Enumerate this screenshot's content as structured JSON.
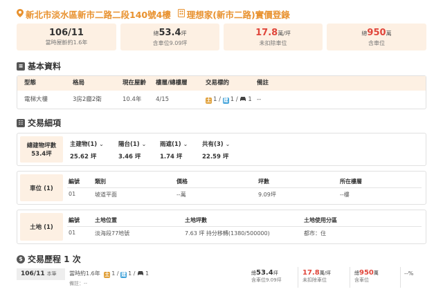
{
  "header": {
    "address": "新北市淡水區新市二路二段140號4樓",
    "community": "理想家(新市二路)實價登錄"
  },
  "summary": [
    {
      "main": "106/11",
      "sub": "當時屋齡約1.6年"
    },
    {
      "prefix": "總",
      "main": "53.4",
      "unit": "坪",
      "sub": "含車位9.09坪"
    },
    {
      "main": "17.8",
      "unit": "萬/坪",
      "sub": "未扣除車位"
    },
    {
      "prefix": "總",
      "main": "950",
      "unit": "萬",
      "sub": "含車位"
    }
  ],
  "basic": {
    "title": "基本資料",
    "headers": [
      "型態",
      "格局",
      "現在屋齡",
      "樓層/總樓層",
      "交易標的",
      "備註"
    ],
    "row": {
      "type": "電梯大樓",
      "layout": "3房2廳2衛",
      "age": "10.4年",
      "floor": "4/15",
      "t1": "1",
      "t2": "1",
      "t3": "1",
      "note": "--"
    }
  },
  "trade": {
    "title": "交易細項",
    "total_label": "總建物坪數",
    "total_value": "53.4坪",
    "cols": [
      {
        "label": "主建物(1)",
        "value": "25.62 坪"
      },
      {
        "label": "陽台(1)",
        "value": "3.46 坪"
      },
      {
        "label": "雨遮(1)",
        "value": "1.74 坪"
      },
      {
        "label": "共有(3)",
        "value": "22.59 坪"
      }
    ],
    "chevron": "⌄",
    "parking": {
      "label": "車位 (1)",
      "headers": [
        "編號",
        "類別",
        "價格",
        "坪數",
        "所在樓層"
      ],
      "row": [
        "01",
        "坡道平面",
        "--萬",
        "9.09坪",
        "--樓"
      ]
    },
    "land": {
      "label": "土地 (1)",
      "headers": [
        "編號",
        "土地位置",
        "土地坪數",
        "土地使用分區"
      ],
      "row": [
        "01",
        "淡海段77地號",
        "7.63 坪 持分移轉(1380/500000)",
        "都市：住"
      ]
    }
  },
  "history": {
    "title": "交易歷程 1 次",
    "date": "106/11",
    "tag": "本筆",
    "age": "當時約1.6年",
    "t1": "1",
    "t2": "1",
    "t3": "1",
    "note": "備註：--",
    "area_prefix": "總",
    "area": "53.4",
    "area_unit": "坪",
    "area_sub": "含車位9.09坪",
    "unit_price": "17.8",
    "unit_price_unit": "萬/坪",
    "unit_price_sub": "未扣除車位",
    "total_prefix": "總",
    "total": "950",
    "total_unit": "萬",
    "total_sub": "含車位",
    "change": "--%"
  },
  "colors": {
    "accent": "#e8912e",
    "highlight": "#e0453a",
    "card_bg": "#fdf0e3"
  }
}
